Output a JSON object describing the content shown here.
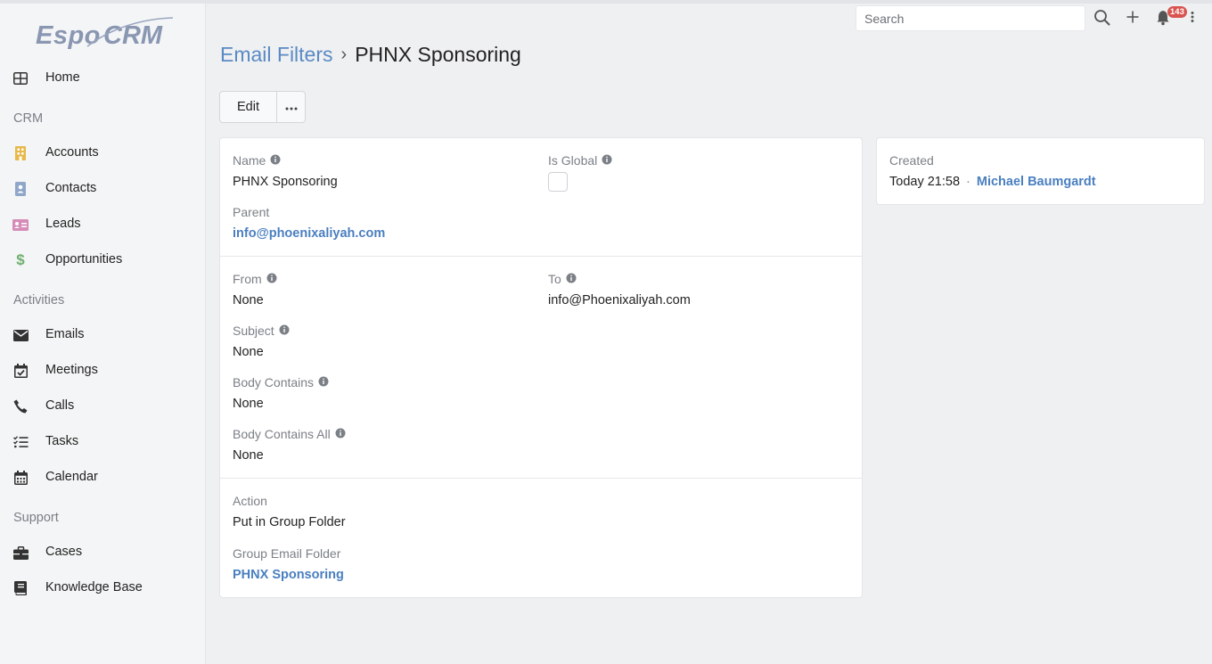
{
  "app": {
    "logo_text": "EspoCRM"
  },
  "sidebar": {
    "items": [
      {
        "label": "Home",
        "icon": "home-grid-icon"
      },
      {
        "group": "CRM"
      },
      {
        "label": "Accounts",
        "icon": "building-icon",
        "color": "#e8b84a"
      },
      {
        "label": "Contacts",
        "icon": "contact-card-icon",
        "color": "#8fa6c9"
      },
      {
        "label": "Leads",
        "icon": "id-card-icon",
        "color": "#d58db8"
      },
      {
        "label": "Opportunities",
        "icon": "dollar-icon",
        "color": "#6fb06f"
      },
      {
        "group": "Activities"
      },
      {
        "label": "Emails",
        "icon": "envelope-icon"
      },
      {
        "label": "Meetings",
        "icon": "calendar-check-icon"
      },
      {
        "label": "Calls",
        "icon": "phone-icon"
      },
      {
        "label": "Tasks",
        "icon": "tasks-icon"
      },
      {
        "label": "Calendar",
        "icon": "calendar-icon"
      },
      {
        "group": "Support"
      },
      {
        "label": "Cases",
        "icon": "briefcase-icon"
      },
      {
        "label": "Knowledge Base",
        "icon": "book-icon"
      }
    ],
    "more": "..."
  },
  "topbar": {
    "search_placeholder": "Search",
    "notification_count": "143"
  },
  "header": {
    "breadcrumb_parent": "Email Filters",
    "title": "PHNX Sponsoring"
  },
  "actions": {
    "edit_label": "Edit",
    "more_label": "•••"
  },
  "record": {
    "name": {
      "label": "Name",
      "value": "PHNX Sponsoring"
    },
    "is_global": {
      "label": "Is Global",
      "checked": false
    },
    "parent": {
      "label": "Parent",
      "value": "info@phoenixaliyah.com"
    },
    "from": {
      "label": "From",
      "value": "None"
    },
    "to": {
      "label": "To",
      "value": "info@Phoenixaliyah.com"
    },
    "subject": {
      "label": "Subject",
      "value": "None"
    },
    "body_contains": {
      "label": "Body Contains",
      "value": "None"
    },
    "body_contains_all": {
      "label": "Body Contains All",
      "value": "None"
    },
    "action": {
      "label": "Action",
      "value": "Put in Group Folder"
    },
    "group_email_folder": {
      "label": "Group Email Folder",
      "value": "PHNX Sponsoring"
    }
  },
  "side_panel": {
    "created_label": "Created",
    "created_time": "Today 21:58",
    "created_separator": "·",
    "created_by": "Michael Baumgardt"
  },
  "colors": {
    "link": "#4a7fc0",
    "breadcrumb_link": "#5a8ac4",
    "badge": "#d9534f"
  }
}
